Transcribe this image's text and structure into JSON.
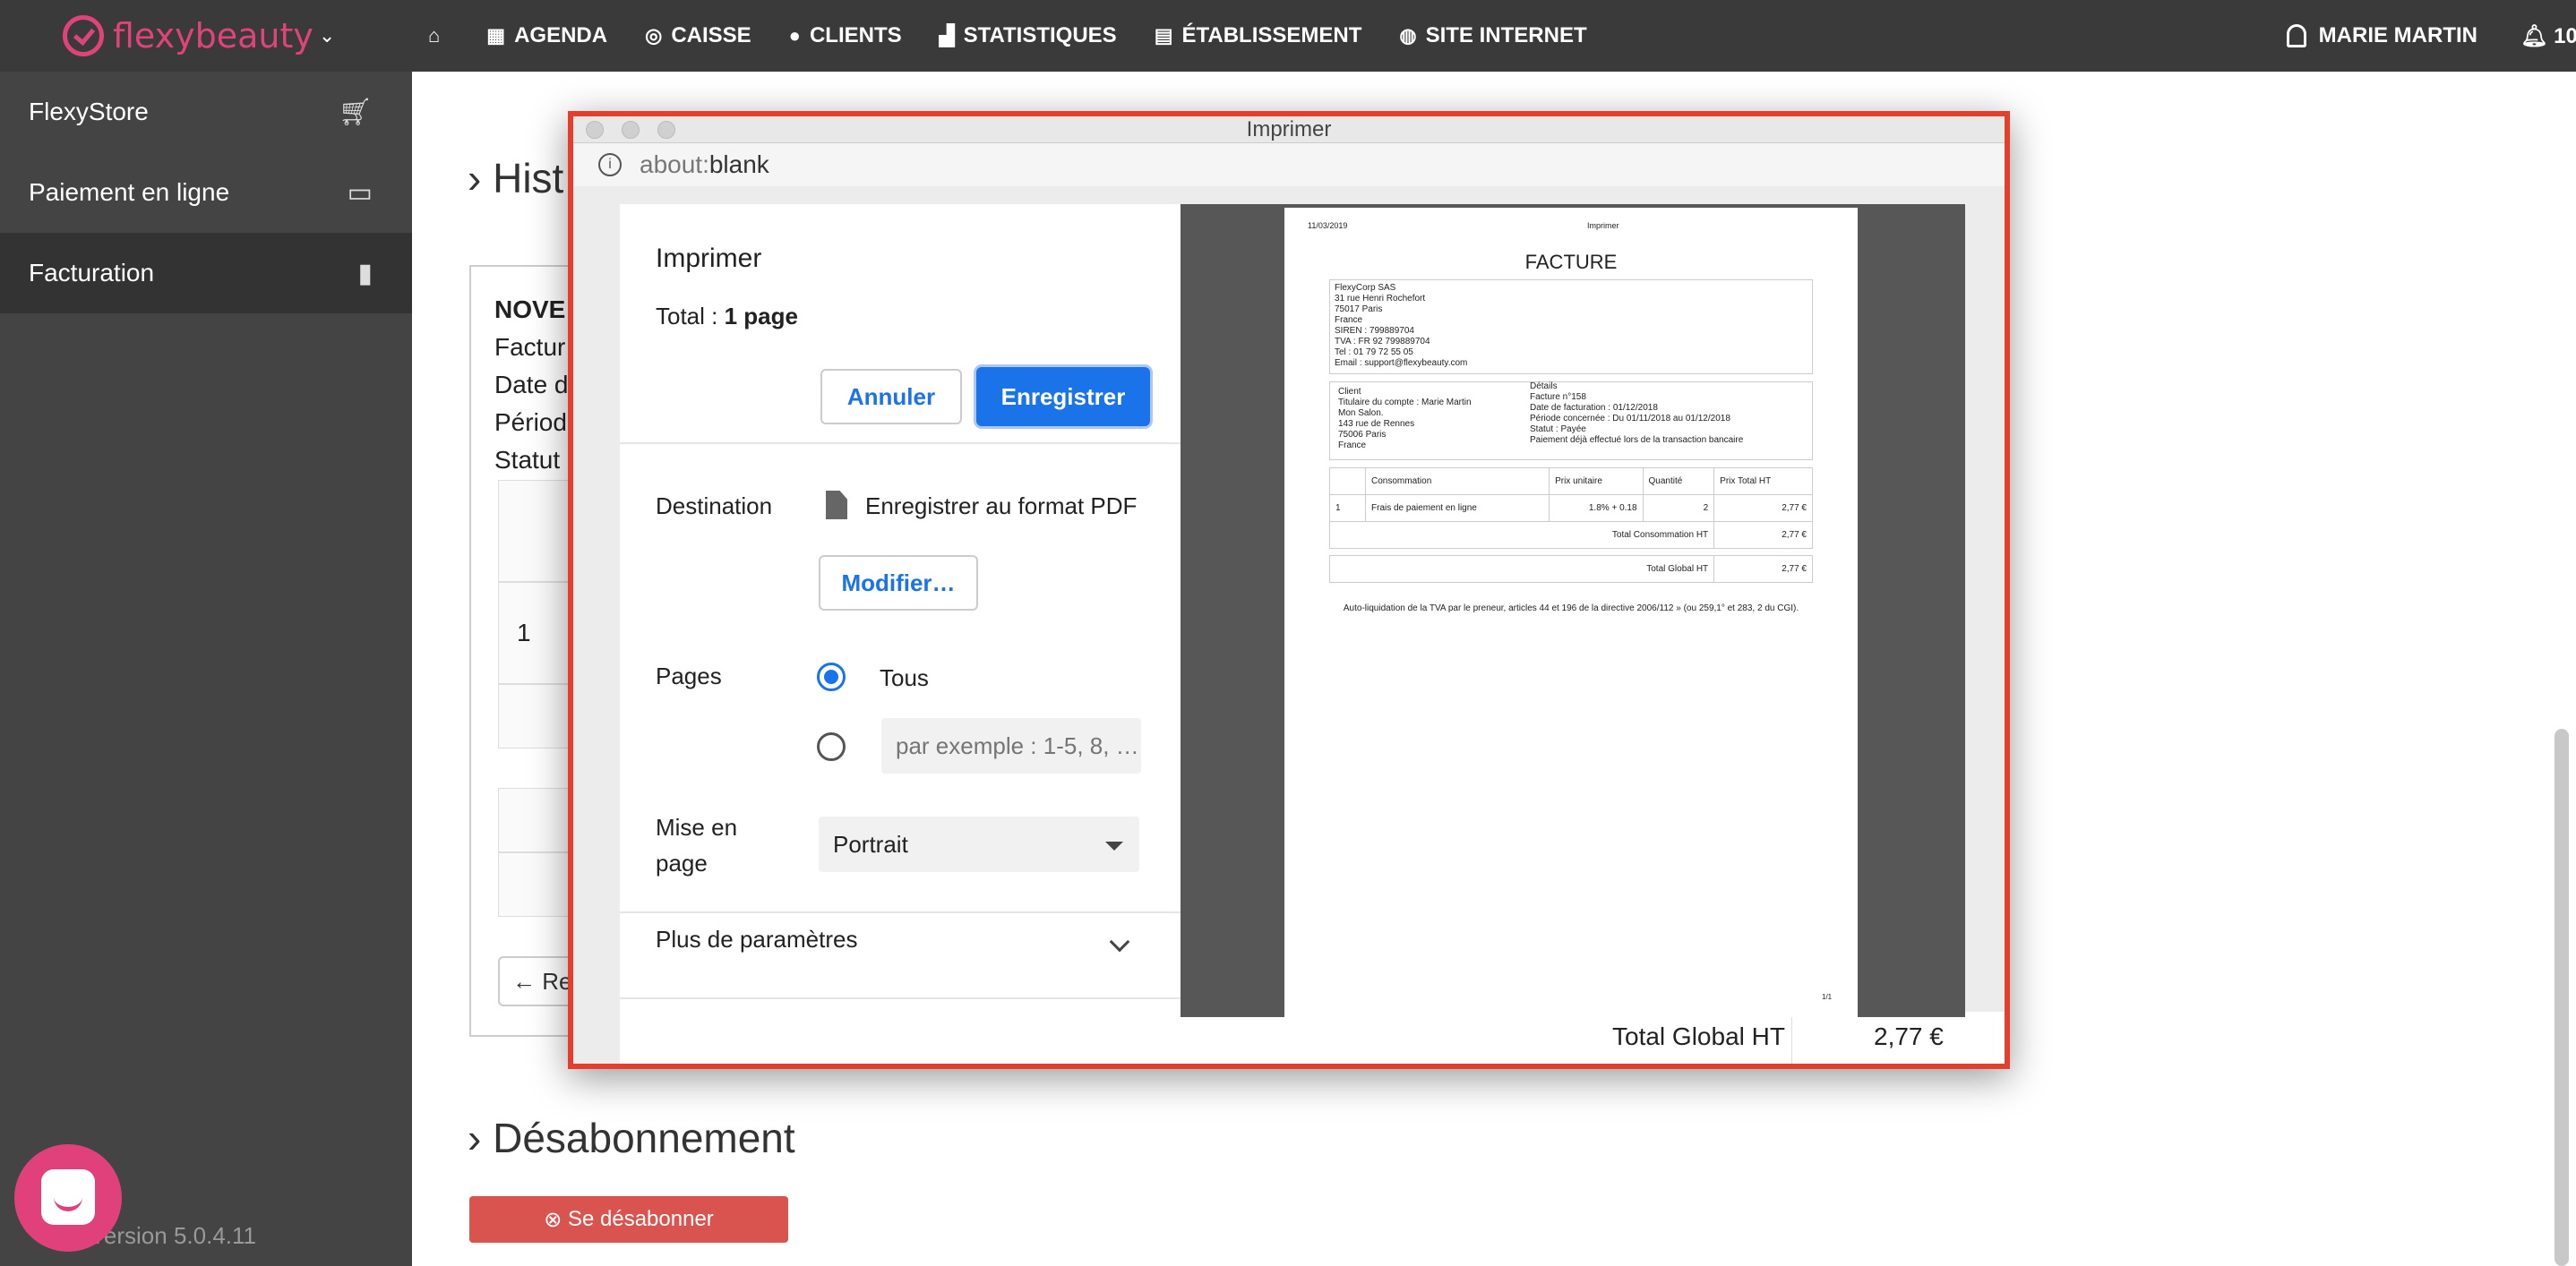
{
  "topnav": {
    "logo": {
      "part1": "flexy",
      "part2": "beauty"
    },
    "items": [
      {
        "label": "AGENDA",
        "icon": "calendar-icon"
      },
      {
        "label": "CAISSE",
        "icon": "coins-icon"
      },
      {
        "label": "CLIENTS",
        "icon": "users-icon"
      },
      {
        "label": "STATISTIQUES",
        "icon": "chart-icon"
      },
      {
        "label": "ÉTABLISSEMENT",
        "icon": "store-icon"
      },
      {
        "label": "SITE INTERNET",
        "icon": "globe-icon"
      }
    ],
    "user": "MARIE MARTIN",
    "notifications": "10"
  },
  "sidebar": {
    "items": [
      {
        "label": "FlexyStore",
        "icon": "cart-icon"
      },
      {
        "label": "Paiement en ligne",
        "icon": "credit-card-icon"
      },
      {
        "label": "Facturation",
        "icon": "document-icon"
      }
    ],
    "version": "Version 5.0.4.11"
  },
  "main": {
    "history_heading": "Hist",
    "card_lines": [
      "NOVE",
      "Factur",
      "Date d",
      "Périod",
      "Statut"
    ],
    "row_number": "1",
    "back_button": "Re",
    "unsubscribe_heading": "Désabonnement",
    "unsubscribe_button": "Se désabonner",
    "total_global_label": "Total Global HT",
    "total_global_value": "2,77 €"
  },
  "print_window": {
    "title": "Imprimer",
    "url_gray": "about:",
    "url_rest": "blank",
    "panel": {
      "title": "Imprimer",
      "total_prefix": "Total : ",
      "total_value": "1 page",
      "cancel_button": "Annuler",
      "save_button": "Enregistrer",
      "destination_label": "Destination",
      "destination_value": "Enregistrer au format PDF",
      "modify_button": "Modifier…",
      "pages_label": "Pages",
      "pages_all": "Tous",
      "pages_placeholder": "par exemple : 1-5, 8, …",
      "layout_label": "Mise en page",
      "layout_value": "Portrait",
      "more_settings": "Plus de paramètres"
    },
    "preview": {
      "date": "11/03/2019",
      "header_title": "Imprimer",
      "title": "FACTURE",
      "company": [
        "FlexyCorp SAS",
        "31 rue Henri Rochefort",
        "75017 Paris",
        "France",
        "SIREN : 799889704",
        "TVA : FR 92 799889704",
        "Tel : 01 79 72 55 05",
        "Email : support@flexybeauty.com"
      ],
      "client": [
        "Client",
        "Titulaire du compte : Marie Martin",
        "Mon Salon.",
        "143 rue de Rennes",
        "75006 Paris",
        "France"
      ],
      "details": [
        "Détails",
        "Facture n°158",
        "Date de facturation : 01/12/2018",
        "Période concernée : Du 01/11/2018 au 01/12/2018",
        "Statut : Payée",
        "Paiement déjà effectué lors de la transaction bancaire"
      ],
      "table_headers": [
        "Consommation",
        "Prix unitaire",
        "Quantité",
        "Prix Total HT"
      ],
      "row": {
        "num": "1",
        "label": "Frais de paiement en ligne",
        "unit": "1.8% + 0.18",
        "qty": "2",
        "total": "2,77 €"
      },
      "total_conso_label": "Total Consommation HT",
      "total_conso_value": "2,77 €",
      "total_global_label": "Total Global HT",
      "total_global_value": "2,77 €",
      "note": "Auto-liquidation de la TVA par le preneur, articles 44 et 196 de la directive 2006/112 » (ou 259,1° et 283, 2 du CGI).",
      "page_num": "1/1"
    }
  }
}
